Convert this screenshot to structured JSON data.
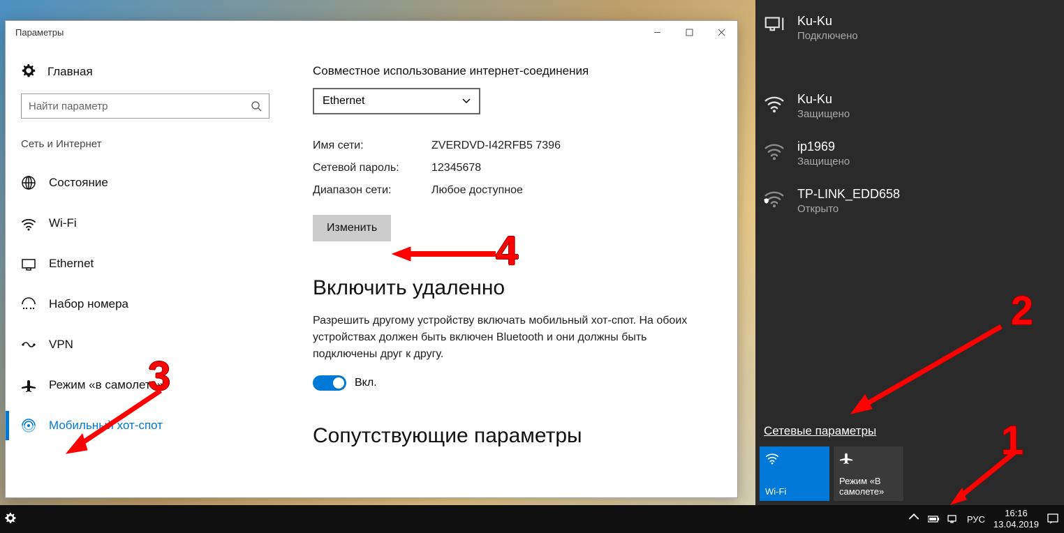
{
  "settings_window": {
    "title": "Параметры",
    "home": "Главная",
    "search_placeholder": "Найти параметр",
    "section": "Сеть и Интернет",
    "nav": [
      {
        "label": "Состояние",
        "icon": "status"
      },
      {
        "label": "Wi-Fi",
        "icon": "wifi"
      },
      {
        "label": "Ethernet",
        "icon": "ethernet"
      },
      {
        "label": "Набор номера",
        "icon": "dialup"
      },
      {
        "label": "VPN",
        "icon": "vpn"
      },
      {
        "label": "Режим «в самолете»",
        "icon": "airplane"
      },
      {
        "label": "Мобильный хот-спот",
        "icon": "hotspot",
        "active": true
      }
    ],
    "content": {
      "share_heading": "Совместное использование интернет-соединения",
      "dropdown_value": "Ethernet",
      "fields": {
        "name_label": "Имя сети:",
        "name_value": "ZVERDVD-I42RFB5 7396",
        "pass_label": "Сетевой пароль:",
        "pass_value": "12345678",
        "band_label": "Диапазон сети:",
        "band_value": "Любое доступное"
      },
      "edit_button": "Изменить",
      "remote_heading": "Включить удаленно",
      "remote_body": "Разрешить другому устройству включать мобильный хот-спот. На обоих устройствах должен быть включен Bluetooth и они должны быть подключены друг к другу.",
      "toggle_label": "Вкл.",
      "related_heading": "Сопутствующие параметры"
    }
  },
  "flyout": {
    "networks": [
      {
        "name": "Ku-Ku",
        "status": "Подключено",
        "icon": "wired"
      },
      {
        "name": "Ku-Ku",
        "status": "Защищено",
        "icon": "wifi"
      },
      {
        "name": "ip1969",
        "status": "Защищено",
        "icon": "wifi-dim"
      },
      {
        "name": "TP-LINK_EDD658",
        "status": "Открыто",
        "icon": "wifi-open"
      }
    ],
    "link": "Сетевые параметры",
    "tiles": {
      "wifi": "Wi-Fi",
      "airplane": "Режим «В самолете»"
    }
  },
  "taskbar": {
    "lang": "РУС",
    "time": "16:16",
    "date": "13.04.2019"
  },
  "annotations": {
    "n1": "1",
    "n2": "2",
    "n3": "3",
    "n4": "4"
  }
}
